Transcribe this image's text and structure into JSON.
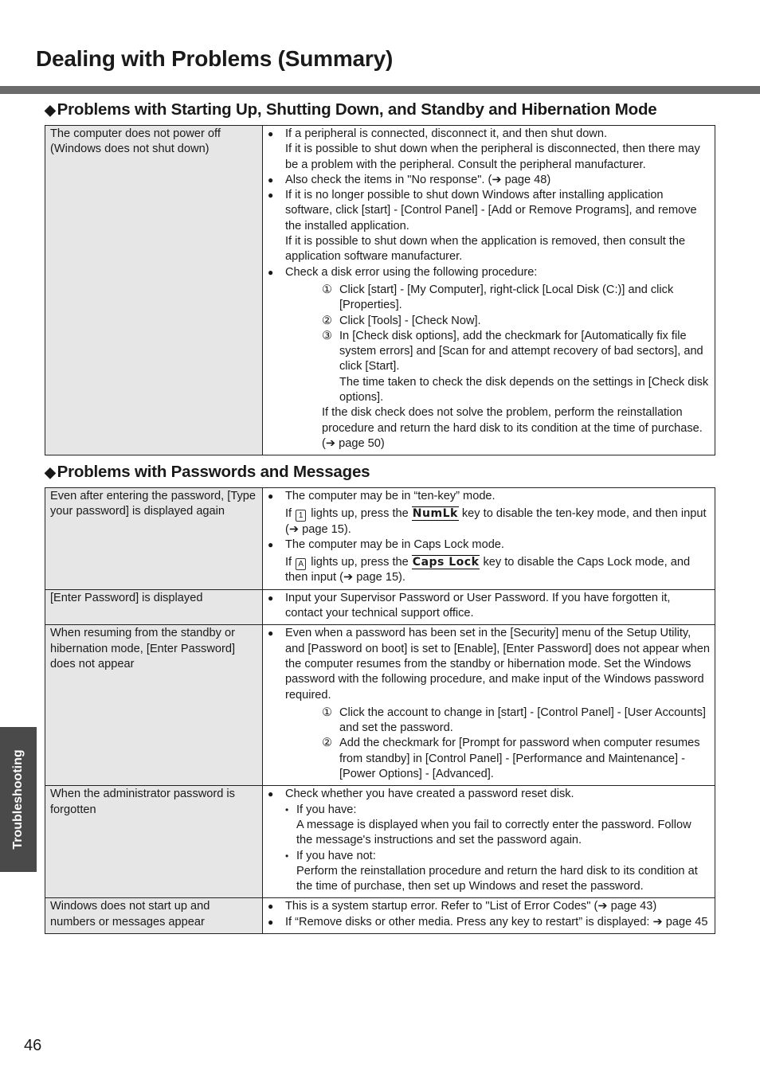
{
  "page": {
    "title": "Dealing with Problems (Summary)",
    "side_tab": "Troubleshooting",
    "page_number": "46"
  },
  "icons": {
    "bullet": "filled-circle",
    "diamond": "◆",
    "arrow": "➔"
  },
  "section1": {
    "heading": "Problems with Starting Up, Shutting Down, and Standby and Hibernation Mode",
    "rows": [
      {
        "condition": "The computer does not power off (Windows does not shut down)",
        "b1": "If a peripheral is connected, disconnect it, and then shut down.",
        "b1_cont": "If it is possible to shut down when the peripheral is disconnected, then there may be a problem with the peripheral. Consult the peripheral manufacturer.",
        "b2": "Also check the items in \"No response\". (➔ page 48)",
        "b3": "If it is no longer possible to shut down Windows after installing application software, click [start] - [Control Panel] - [Add or Remove Programs], and remove the installed application.",
        "b3_cont": "If it is possible to shut down when the application is removed, then consult the application software manufacturer.",
        "b4": "Check a disk error using the following procedure:",
        "steps": [
          {
            "num": "①",
            "text": "Click [start] - [My Computer], right-click [Local Disk (C:)] and click [Properties]."
          },
          {
            "num": "②",
            "text": "Click [Tools] - [Check Now]."
          },
          {
            "num": "③",
            "text": "In [Check disk options], add the checkmark for [Automatically fix file system errors] and [Scan for and attempt recovery of bad sectors], and click [Start].",
            "note": "The time taken to check the disk depends on the settings in [Check disk options]."
          }
        ],
        "after": "If the disk check does not solve the problem, perform the reinstallation procedure and return the hard disk to its condition at the time of purchase. (➔ page 50)"
      }
    ]
  },
  "section2": {
    "heading": "Problems with Passwords and Messages",
    "rows": [
      {
        "condition": "Even after entering the password, [Type your password] is displayed again",
        "b1": "The computer may be in “ten-key” mode.",
        "b1_pre": "If",
        "b1_led": "1",
        "b1_mid": "lights up, press the",
        "b1_key": "NumLk",
        "b1_post": "key to disable the ten-key mode, and then input (➔ page 15).",
        "b2": "The computer may be in Caps Lock mode.",
        "b2_pre": "If",
        "b2_led": "A",
        "b2_mid": "lights up, press the",
        "b2_key": "Caps Lock",
        "b2_post": "key to disable the Caps Lock mode, and then input (➔ page 15)."
      },
      {
        "condition": "[Enter Password] is displayed",
        "b1": "Input your Supervisor Password or User Password. If you have forgotten it, contact your technical support office."
      },
      {
        "condition": "When resuming from the standby or hibernation mode, [Enter Password] does not appear",
        "b1": "Even when a password has been set in the [Security] menu of the Setup Utility, and [Password on boot] is set to [Enable], [Enter Password] does not appear when the computer resumes from the standby or hibernation mode. Set the Windows password with the following procedure, and make input of the Windows password required.",
        "steps": [
          {
            "num": "①",
            "text": "Click the account to change in [start] - [Control Panel] - [User Accounts] and set the password."
          },
          {
            "num": "②",
            "text": "Add the checkmark for [Prompt for password when computer resumes from standby] in [Control Panel] - [Performance and Maintenance] - [Power Options] - [Advanced]."
          }
        ]
      },
      {
        "condition": "When the administrator password is forgotten",
        "b1": "Check whether you have created a password reset disk.",
        "sub1": "If you have:",
        "sub1_text": "A message is displayed when you fail to correctly enter the password. Follow the message's instructions and set the password again.",
        "sub2": "If you have not:",
        "sub2_text": "Perform the reinstallation procedure and return the hard disk to its condition at the time of purchase, then set up Windows and reset the password."
      },
      {
        "condition": "Windows does not start up and numbers or messages appear",
        "b1": "This is a system startup error. Refer to \"List of Error Codes\" (➔ page 43)",
        "b2": "If “Remove disks or other media. Press any key to restart” is displayed: ➔ page 45"
      }
    ]
  }
}
